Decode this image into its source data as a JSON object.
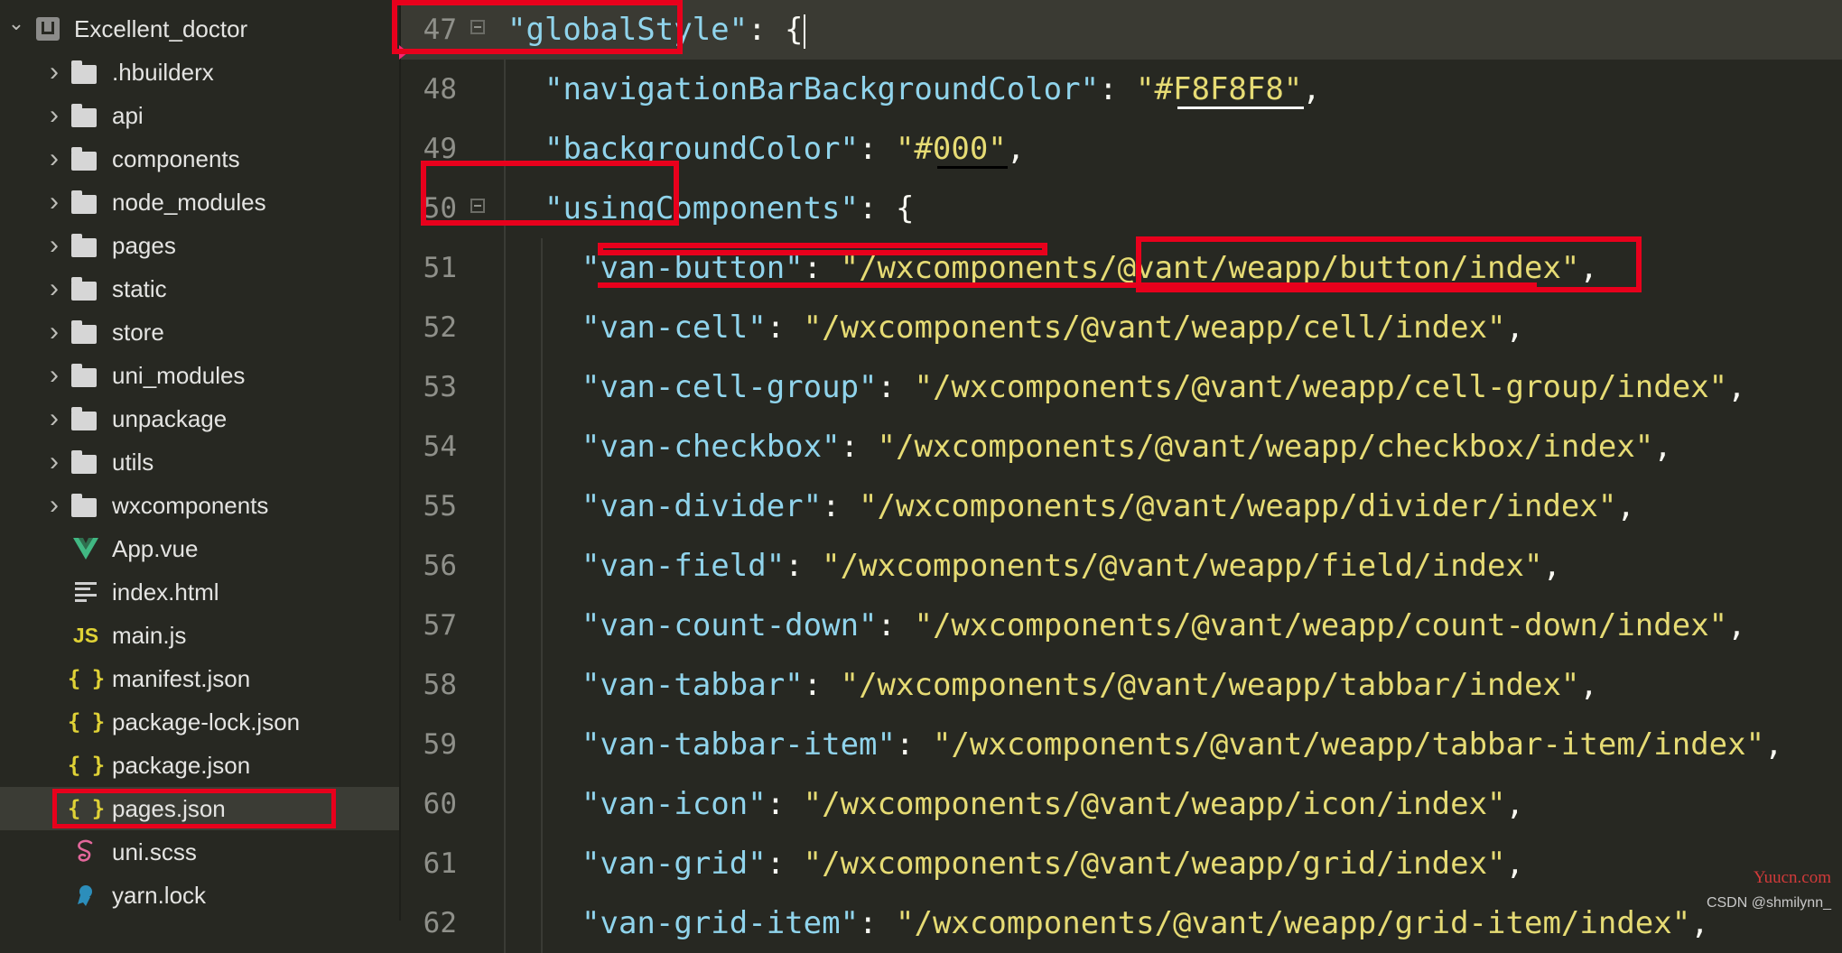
{
  "sidebar": {
    "project": "Excellent_doctor",
    "folders": [
      ".hbuilderx",
      "api",
      "components",
      "node_modules",
      "pages",
      "static",
      "store",
      "uni_modules",
      "unpackage",
      "utils",
      "wxcomponents"
    ],
    "files": [
      {
        "label": "App.vue",
        "icon": "vue-icon"
      },
      {
        "label": "index.html",
        "icon": "html-lines-icon"
      },
      {
        "label": "main.js",
        "icon": "js-icon"
      },
      {
        "label": "manifest.json",
        "icon": "json-icon"
      },
      {
        "label": "package-lock.json",
        "icon": "json-icon"
      },
      {
        "label": "package.json",
        "icon": "json-icon"
      },
      {
        "label": "pages.json",
        "icon": "json-icon"
      },
      {
        "label": "uni.scss",
        "icon": "sass-icon"
      },
      {
        "label": "yarn.lock",
        "icon": "yarn-icon"
      }
    ],
    "json_glyph": "{ }",
    "js_glyph": "JS",
    "selected_file": "pages.json"
  },
  "editor": {
    "lines": [
      {
        "num": "47",
        "tokens": [
          {
            "t": "\"globalStyle\"",
            "c": "k"
          },
          {
            "t": ": {",
            "c": "p"
          }
        ]
      },
      {
        "num": "48",
        "tokens": [
          {
            "t": "\"navigationBarBackgroundColor\"",
            "c": "k"
          },
          {
            "t": ": ",
            "c": "p"
          },
          {
            "t": "\"#F8F8F8\"",
            "c": "s"
          },
          {
            "t": ",",
            "c": "p"
          }
        ]
      },
      {
        "num": "49",
        "tokens": [
          {
            "t": "\"backgroundColor\"",
            "c": "k"
          },
          {
            "t": ": ",
            "c": "p"
          },
          {
            "t": "\"#000\"",
            "c": "s"
          },
          {
            "t": ",",
            "c": "p"
          }
        ]
      },
      {
        "num": "50",
        "tokens": [
          {
            "t": "\"usingComponents\"",
            "c": "k"
          },
          {
            "t": ": {",
            "c": "p"
          }
        ]
      },
      {
        "num": "51",
        "tokens": [
          {
            "t": "\"van-button\"",
            "c": "k"
          },
          {
            "t": ": ",
            "c": "p"
          },
          {
            "t": "\"/wxcomponents/@vant/weapp/button/index\"",
            "c": "s"
          },
          {
            "t": ",",
            "c": "p"
          }
        ]
      },
      {
        "num": "52",
        "tokens": [
          {
            "t": "\"van-cell\"",
            "c": "k"
          },
          {
            "t": ": ",
            "c": "p"
          },
          {
            "t": "\"/wxcomponents/@vant/weapp/cell/index\"",
            "c": "s"
          },
          {
            "t": ",",
            "c": "p"
          }
        ]
      },
      {
        "num": "53",
        "tokens": [
          {
            "t": "\"van-cell-group\"",
            "c": "k"
          },
          {
            "t": ": ",
            "c": "p"
          },
          {
            "t": "\"/wxcomponents/@vant/weapp/cell-group/index\"",
            "c": "s"
          },
          {
            "t": ",",
            "c": "p"
          }
        ]
      },
      {
        "num": "54",
        "tokens": [
          {
            "t": "\"van-checkbox\"",
            "c": "k"
          },
          {
            "t": ": ",
            "c": "p"
          },
          {
            "t": "\"/wxcomponents/@vant/weapp/checkbox/index\"",
            "c": "s"
          },
          {
            "t": ",",
            "c": "p"
          }
        ]
      },
      {
        "num": "55",
        "tokens": [
          {
            "t": "\"van-divider\"",
            "c": "k"
          },
          {
            "t": ": ",
            "c": "p"
          },
          {
            "t": "\"/wxcomponents/@vant/weapp/divider/index\"",
            "c": "s"
          },
          {
            "t": ",",
            "c": "p"
          }
        ]
      },
      {
        "num": "56",
        "tokens": [
          {
            "t": "\"van-field\"",
            "c": "k"
          },
          {
            "t": ": ",
            "c": "p"
          },
          {
            "t": "\"/wxcomponents/@vant/weapp/field/index\"",
            "c": "s"
          },
          {
            "t": ",",
            "c": "p"
          }
        ]
      },
      {
        "num": "57",
        "tokens": [
          {
            "t": "\"van-count-down\"",
            "c": "k"
          },
          {
            "t": ": ",
            "c": "p"
          },
          {
            "t": "\"/wxcomponents/@vant/weapp/count-down/index\"",
            "c": "s"
          },
          {
            "t": ",",
            "c": "p"
          }
        ]
      },
      {
        "num": "58",
        "tokens": [
          {
            "t": "\"van-tabbar\"",
            "c": "k"
          },
          {
            "t": ": ",
            "c": "p"
          },
          {
            "t": "\"/wxcomponents/@vant/weapp/tabbar/index\"",
            "c": "s"
          },
          {
            "t": ",",
            "c": "p"
          }
        ]
      },
      {
        "num": "59",
        "tokens": [
          {
            "t": "\"van-tabbar-item\"",
            "c": "k"
          },
          {
            "t": ": ",
            "c": "p"
          },
          {
            "t": "\"/wxcomponents/@vant/weapp/tabbar-item/index\"",
            "c": "s"
          },
          {
            "t": ",",
            "c": "p"
          }
        ]
      },
      {
        "num": "60",
        "tokens": [
          {
            "t": "\"van-icon\"",
            "c": "k"
          },
          {
            "t": ": ",
            "c": "p"
          },
          {
            "t": "\"/wxcomponents/@vant/weapp/icon/index\"",
            "c": "s"
          },
          {
            "t": ",",
            "c": "p"
          }
        ]
      },
      {
        "num": "61",
        "tokens": [
          {
            "t": "\"van-grid\"",
            "c": "k"
          },
          {
            "t": ": ",
            "c": "p"
          },
          {
            "t": "\"/wxcomponents/@vant/weapp/grid/index\"",
            "c": "s"
          },
          {
            "t": ",",
            "c": "p"
          }
        ]
      },
      {
        "num": "62",
        "tokens": [
          {
            "t": "\"van-grid-item\"",
            "c": "k"
          },
          {
            "t": ": ",
            "c": "p"
          },
          {
            "t": "\"/wxcomponents/@vant/weapp/grid-item/index\"",
            "c": "s"
          },
          {
            "t": ",",
            "c": "p"
          }
        ]
      }
    ],
    "current_line": "47",
    "highlight_color": "#e8001c",
    "key_color": "#90d4ec",
    "string_color": "#e6db74"
  },
  "watermark": {
    "brand": "Yuucn.com",
    "credit": "CSDN @shmilynn_"
  }
}
